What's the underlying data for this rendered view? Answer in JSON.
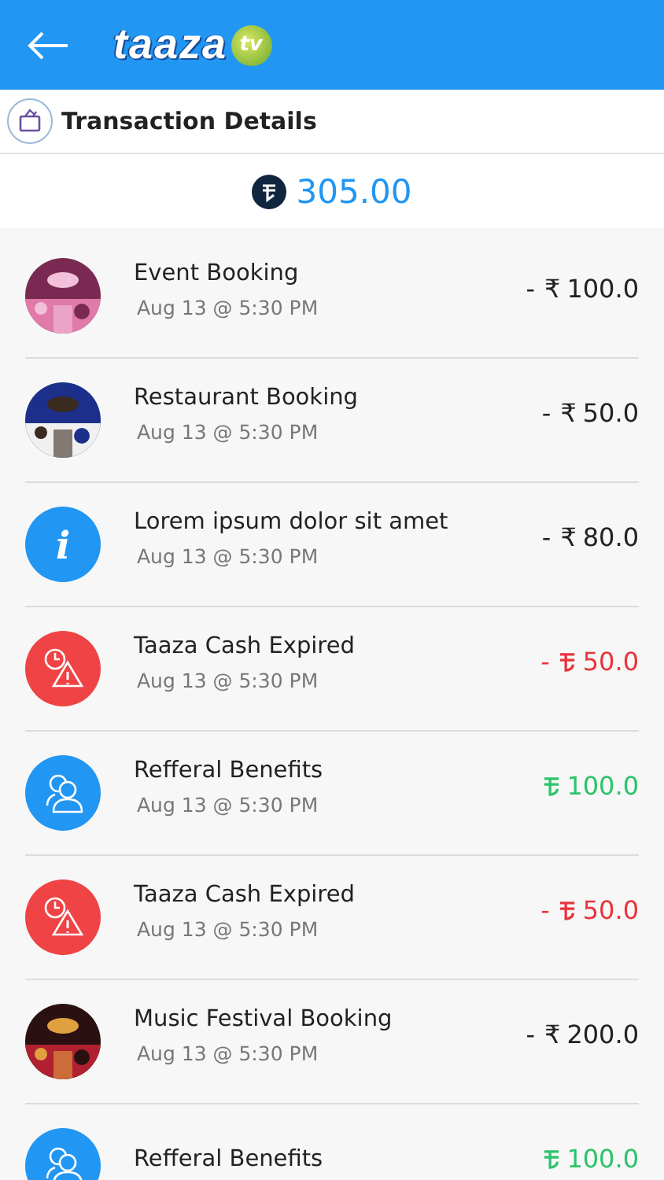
{
  "header": {
    "logo": {
      "text": "taaza",
      "badge": "tv"
    }
  },
  "section": {
    "title": "Transaction Details"
  },
  "balance": {
    "value": "305.00"
  },
  "transactions": [
    {
      "kind": "picture",
      "title": "Event Booking",
      "time": "Aug 13 @ 5:30 PM",
      "amount": {
        "kind": "rupee",
        "sign": "-",
        "symbol": "₹",
        "value": "100.0",
        "color": "#222222"
      }
    },
    {
      "kind": "picture",
      "title": "Restaurant Booking",
      "time": "Aug 13 @ 5:30 PM",
      "amount": {
        "kind": "rupee",
        "sign": "-",
        "symbol": "₹",
        "value": "50.0",
        "color": "#222222"
      }
    },
    {
      "kind": "info",
      "title": "Lorem ipsum dolor sit amet",
      "time": "Aug 13 @ 5:30 PM",
      "icon_text": "i",
      "amount": {
        "kind": "rupee",
        "sign": "-",
        "symbol": "₹",
        "value": "80.0",
        "color": "#222222"
      }
    },
    {
      "kind": "expired",
      "title": "Taaza Cash Expired",
      "time": "Aug 13 @ 5:30 PM",
      "amount": {
        "kind": "coin",
        "sign": "-",
        "value": "50.0",
        "color": "#e8343c"
      }
    },
    {
      "kind": "referral",
      "title": "Refferal Benefits",
      "time": "Aug 13 @ 5:30 PM",
      "amount": {
        "kind": "coin",
        "value": "100.0",
        "color": "#2dc46b"
      }
    },
    {
      "kind": "expired",
      "title": "Taaza Cash Expired",
      "time": "Aug 13 @ 5:30 PM",
      "amount": {
        "kind": "coin",
        "sign": "-",
        "value": "50.0",
        "color": "#e8343c"
      }
    },
    {
      "kind": "picture",
      "title": "Music Festival Booking",
      "time": "Aug 13 @ 5:30 PM",
      "amount": {
        "kind": "rupee",
        "sign": "-",
        "symbol": "₹",
        "value": "200.0",
        "color": "#222222"
      }
    },
    {
      "kind": "referral",
      "title": "Refferal Benefits",
      "amount": {
        "kind": "coin",
        "value": "100.0",
        "color": "#2dc46b"
      }
    }
  ]
}
